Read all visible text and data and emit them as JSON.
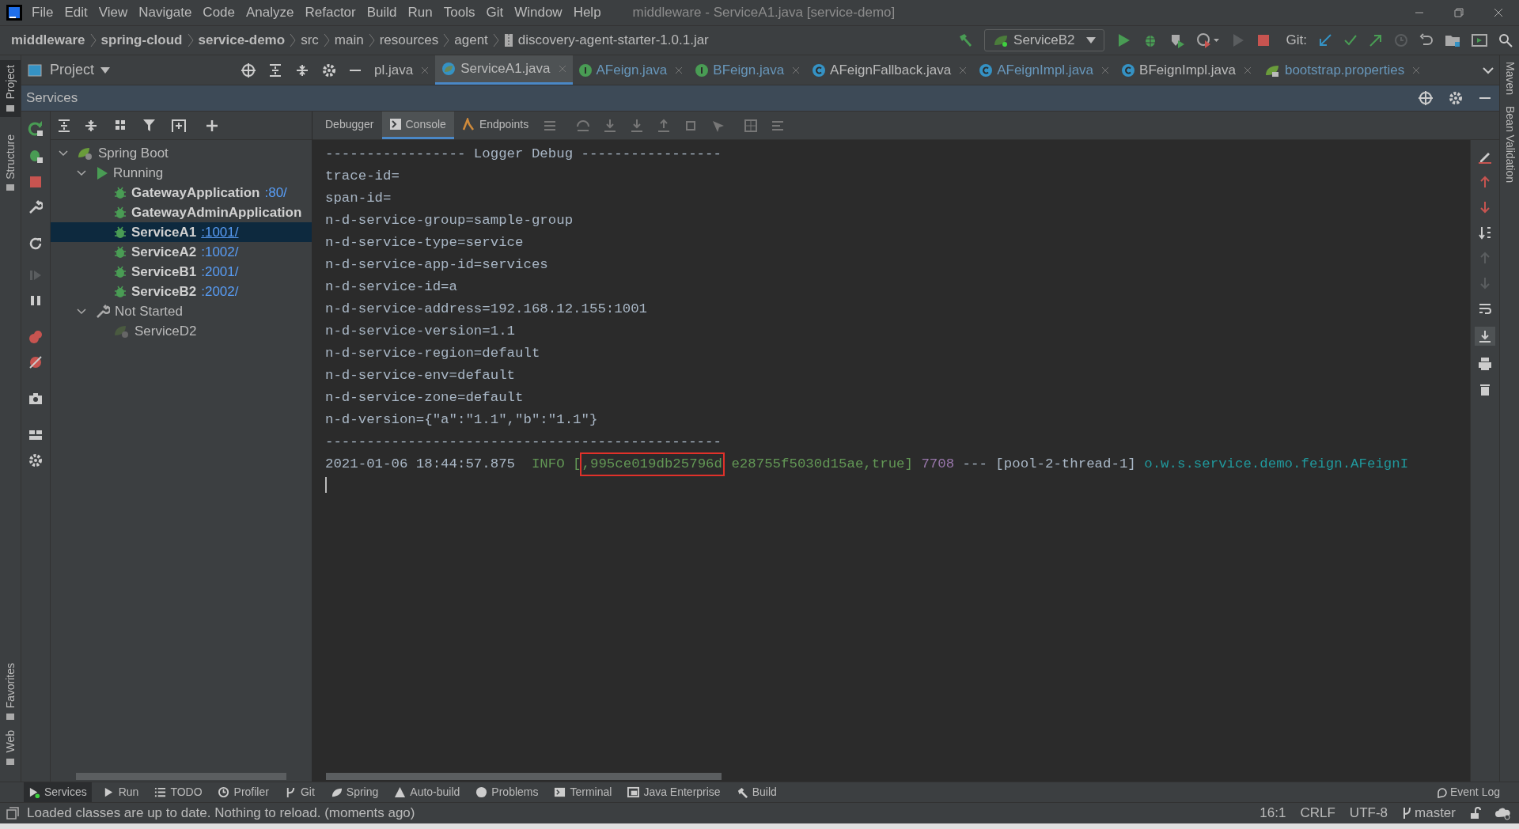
{
  "menu": [
    "File",
    "Edit",
    "View",
    "Navigate",
    "Code",
    "Analyze",
    "Refactor",
    "Build",
    "Run",
    "Tools",
    "Git",
    "Window",
    "Help"
  ],
  "window": {
    "title": "middleware - ServiceA1.java [service-demo]"
  },
  "breadcrumbs": [
    {
      "label": "middleware",
      "bold": true
    },
    {
      "label": "spring-cloud",
      "bold": true
    },
    {
      "label": "service-demo",
      "bold": true
    },
    {
      "label": "src",
      "bold": false
    },
    {
      "label": "main",
      "bold": false
    },
    {
      "label": "resources",
      "bold": false
    },
    {
      "label": "agent",
      "bold": false
    },
    {
      "label": "discovery-agent-starter-1.0.1.jar",
      "bold": false
    }
  ],
  "run_config": "ServiceB2",
  "git_label": "Git:",
  "project_panel": {
    "title": "Project"
  },
  "editor_tabs": [
    {
      "label": "pl.java",
      "kind": "plain",
      "selected": false,
      "modified": false
    },
    {
      "label": "ServiceA1.java",
      "kind": "spring",
      "selected": true,
      "modified": false
    },
    {
      "label": "AFeign.java",
      "kind": "interface",
      "selected": false,
      "modified": true
    },
    {
      "label": "BFeign.java",
      "kind": "interface",
      "selected": false,
      "modified": true
    },
    {
      "label": "AFeignFallback.java",
      "kind": "class",
      "selected": false,
      "modified": false
    },
    {
      "label": "AFeignImpl.java",
      "kind": "class",
      "selected": false,
      "modified": true
    },
    {
      "label": "BFeignImpl.java",
      "kind": "class",
      "selected": false,
      "modified": false
    },
    {
      "label": "bootstrap.properties",
      "kind": "properties",
      "selected": false,
      "modified": true
    }
  ],
  "side_stripe_left": [
    {
      "label": "Project",
      "selected": true
    },
    {
      "label": "Structure",
      "selected": false
    },
    {
      "label": "Favorites",
      "selected": false
    },
    {
      "label": "Web",
      "selected": false
    }
  ],
  "side_stripe_right": [
    "Maven",
    "Bean Validation"
  ],
  "services": {
    "title": "Services",
    "tree": [
      {
        "label": "Spring Boot",
        "kind": "group",
        "expanded": true,
        "children": [
          {
            "label": "Running",
            "kind": "running",
            "expanded": true,
            "children": [
              {
                "label": "GatewayApplication",
                "port": ":80/",
                "kind": "app",
                "selected": false
              },
              {
                "label": "GatewayAdminApplication",
                "kind": "app",
                "selected": false
              },
              {
                "label": "ServiceA1",
                "port": ":1001/",
                "kind": "app",
                "selected": true
              },
              {
                "label": "ServiceA2",
                "port": ":1002/",
                "kind": "app",
                "selected": false
              },
              {
                "label": "ServiceB1",
                "port": ":2001/",
                "kind": "app",
                "selected": false
              },
              {
                "label": "ServiceB2",
                "port": ":2002/",
                "kind": "app",
                "selected": false
              }
            ]
          },
          {
            "label": "Not Started",
            "kind": "stopped",
            "expanded": true,
            "children": [
              {
                "label": "ServiceD2",
                "kind": "idle",
                "selected": false
              }
            ]
          }
        ]
      }
    ],
    "console_tabs": [
      {
        "label": "Debugger",
        "selected": false
      },
      {
        "label": "Console",
        "selected": true
      },
      {
        "label": "Endpoints",
        "selected": false
      }
    ],
    "console_lines": [
      "----------------- Logger Debug -----------------",
      "trace-id=",
      "span-id=",
      "n-d-service-group=sample-group",
      "n-d-service-type=service",
      "n-d-service-app-id=services",
      "n-d-service-id=a",
      "n-d-service-address=192.168.12.155:1001",
      "n-d-service-version=1.1",
      "n-d-service-region=default",
      "n-d-service-env=default",
      "n-d-service-zone=default",
      "n-d-version={\"a\":\"1.1\",\"b\":\"1.1\"}",
      "------------------------------------------------"
    ],
    "log_line": [
      {
        "text": "2021-01-06 18:44:57.875  ",
        "kind": "plain",
        "highlighted": false
      },
      {
        "text": "INFO [",
        "kind": "level",
        "highlighted": false
      },
      {
        "text": ",995ce019db25796d",
        "kind": "level",
        "highlighted": true
      },
      {
        "text": " e28755f5030d15ae,true]",
        "kind": "level",
        "highlighted": false
      },
      {
        "text": " 7708",
        "kind": "pid",
        "highlighted": false
      },
      {
        "text": " --- [pool-2-thread-1] ",
        "kind": "plain",
        "highlighted": false
      },
      {
        "text": "o.w.s.service.demo.feign.AFeignI",
        "kind": "logger",
        "highlighted": false
      }
    ]
  },
  "tool_windows": [
    {
      "label": "Services",
      "selected": true
    },
    {
      "label": "Run",
      "selected": false
    },
    {
      "label": "TODO",
      "selected": false
    },
    {
      "label": "Profiler",
      "selected": false
    },
    {
      "label": "Git",
      "selected": false
    },
    {
      "label": "Spring",
      "selected": false
    },
    {
      "label": "Auto-build",
      "selected": false
    },
    {
      "label": "Problems",
      "selected": false
    },
    {
      "label": "Terminal",
      "selected": false
    },
    {
      "label": "Java Enterprise",
      "selected": false
    },
    {
      "label": "Build",
      "selected": false
    }
  ],
  "event_log": "Event Log",
  "status_bar": {
    "message": "Loaded classes are up to date. Nothing to reload. (moments ago)",
    "position": "16:1",
    "line_separator": "CRLF",
    "encoding": "UTF-8",
    "branch": "master"
  }
}
